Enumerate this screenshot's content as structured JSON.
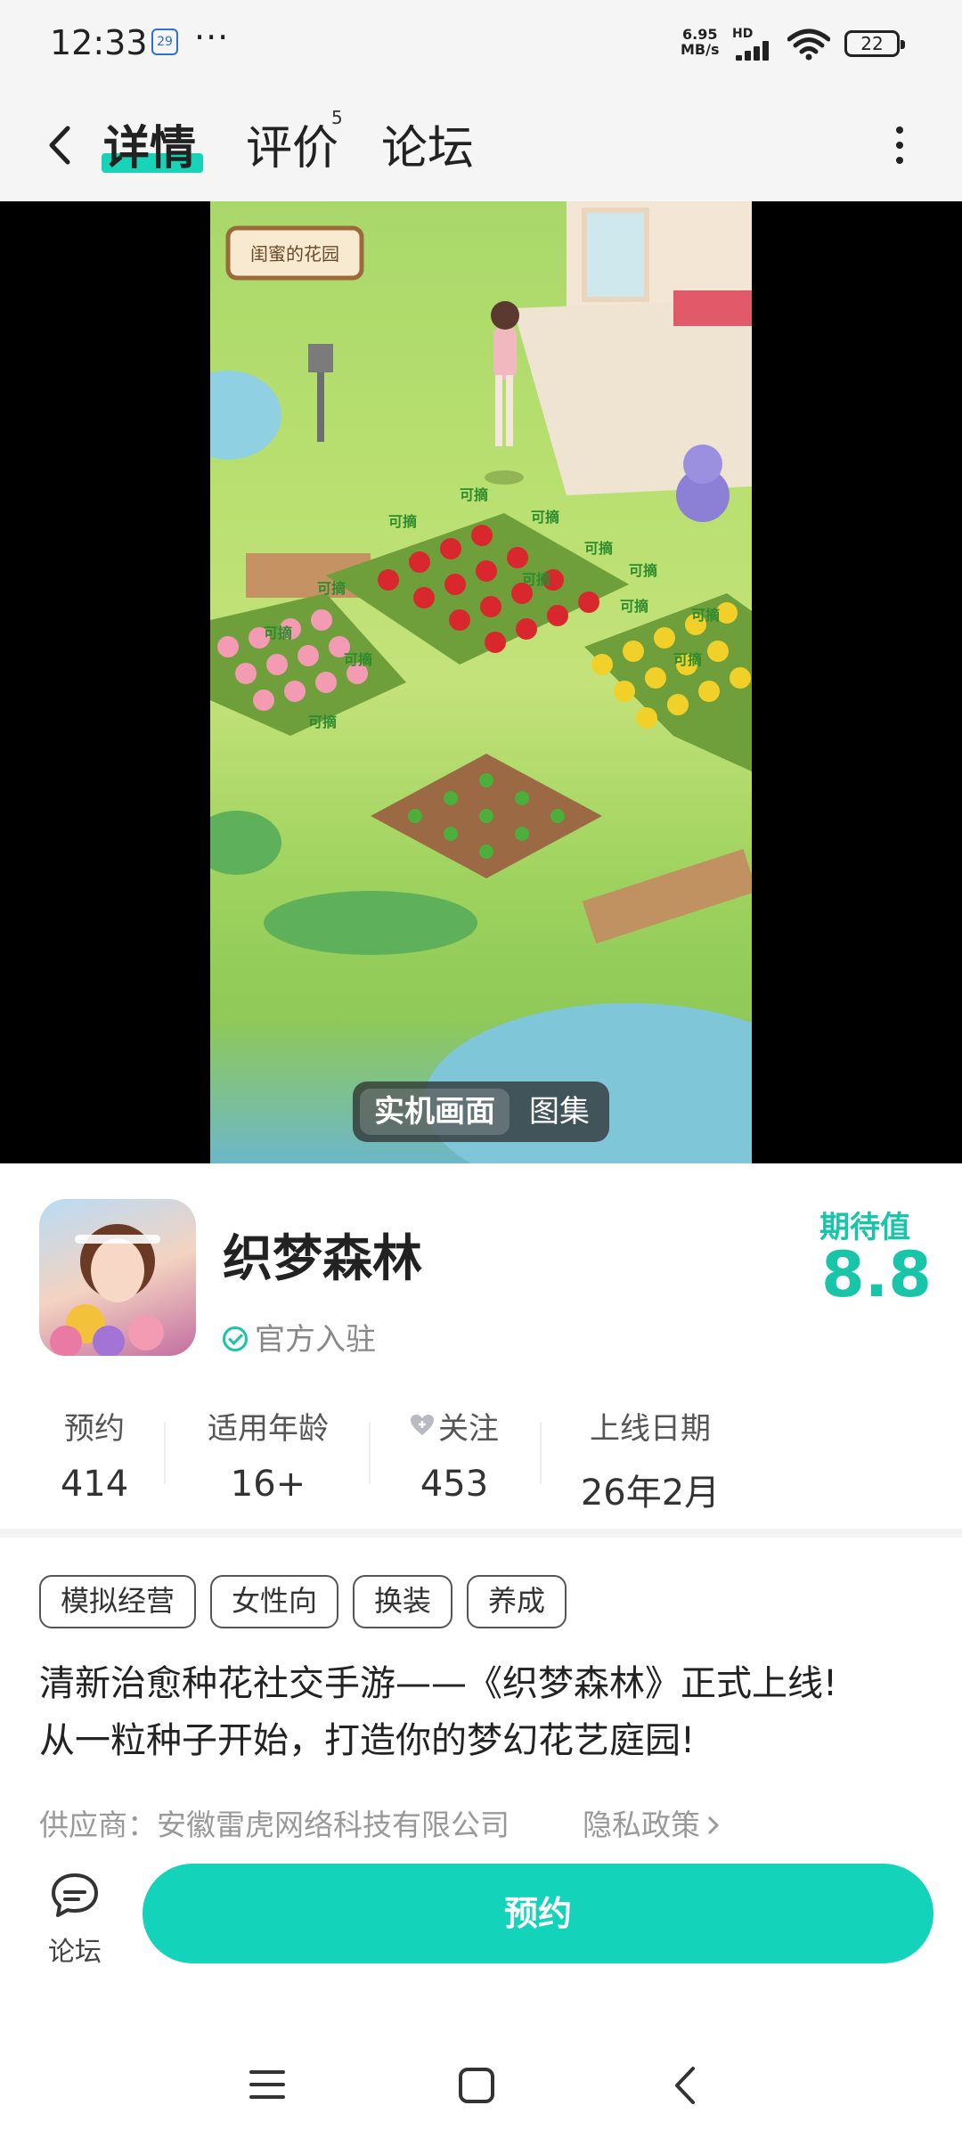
{
  "status_bar": {
    "time": "12:33",
    "calendar_day": "29",
    "more": "···",
    "net_speed_top": "6.95",
    "net_speed_bottom": "MB/s",
    "hd": "HD",
    "battery": "22"
  },
  "nav": {
    "tabs": [
      {
        "label": "详情",
        "active": true
      },
      {
        "label": "评价",
        "count": "5"
      },
      {
        "label": "论坛"
      }
    ]
  },
  "media": {
    "toggle_active": "实机画面",
    "toggle_other": "图集",
    "screenshot_sign": "闺蜜的花园",
    "pick_label": "可摘"
  },
  "app": {
    "name": "织梦森林",
    "official_label": "官方入驻",
    "expect_label": "期待值",
    "expect_value": "8.8",
    "stats": [
      {
        "label": "预约",
        "value": "414"
      },
      {
        "label": "适用年龄",
        "value": "16+"
      },
      {
        "label": "关注",
        "value": "453"
      },
      {
        "label": "上线日期",
        "value": "26年2月"
      }
    ]
  },
  "tags": [
    "模拟经营",
    "女性向",
    "换装",
    "养成"
  ],
  "description": {
    "line1": "清新治愈种花社交手游——《织梦森林》正式上线!",
    "line2": "从一粒种子开始，打造你的梦幻花艺庭园!"
  },
  "supplier": "供应商：安徽雷虎网络科技有限公司",
  "privacy": "隐私政策",
  "bottom": {
    "forum_label": "论坛",
    "reserve_label": "预约"
  },
  "colors": {
    "accent": "#14d3bb",
    "accent_text": "#18c5a9"
  }
}
